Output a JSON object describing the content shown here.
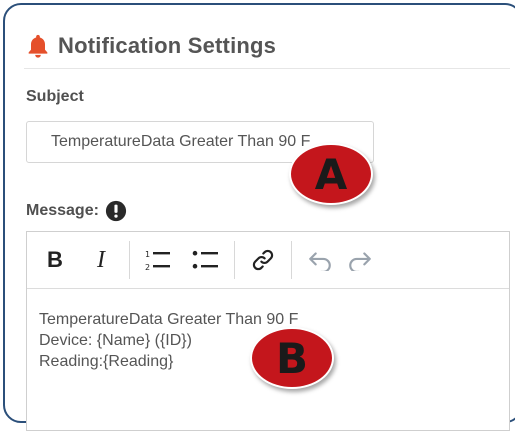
{
  "header": {
    "title": "Notification Settings",
    "icon": "bell-icon",
    "icon_color": "#e5502b"
  },
  "subject": {
    "label": "Subject",
    "value": "TemperatureData Greater Than 90 F"
  },
  "message": {
    "label": "Message:",
    "info_icon": "exclamation-circle-icon",
    "toolbar": {
      "bold": "B",
      "italic": "I",
      "ordered_list_icon": "ordered-list-icon",
      "bullet_list_icon": "bullet-list-icon",
      "link_icon": "link-icon",
      "undo_icon": "undo-icon",
      "redo_icon": "redo-icon"
    },
    "lines": [
      "TemperatureData Greater Than 90 F",
      "Device: {Name} ({ID})",
      "Reading:{Reading}"
    ]
  },
  "callouts": {
    "a": "A",
    "b": "B",
    "color": "#c4161c"
  }
}
